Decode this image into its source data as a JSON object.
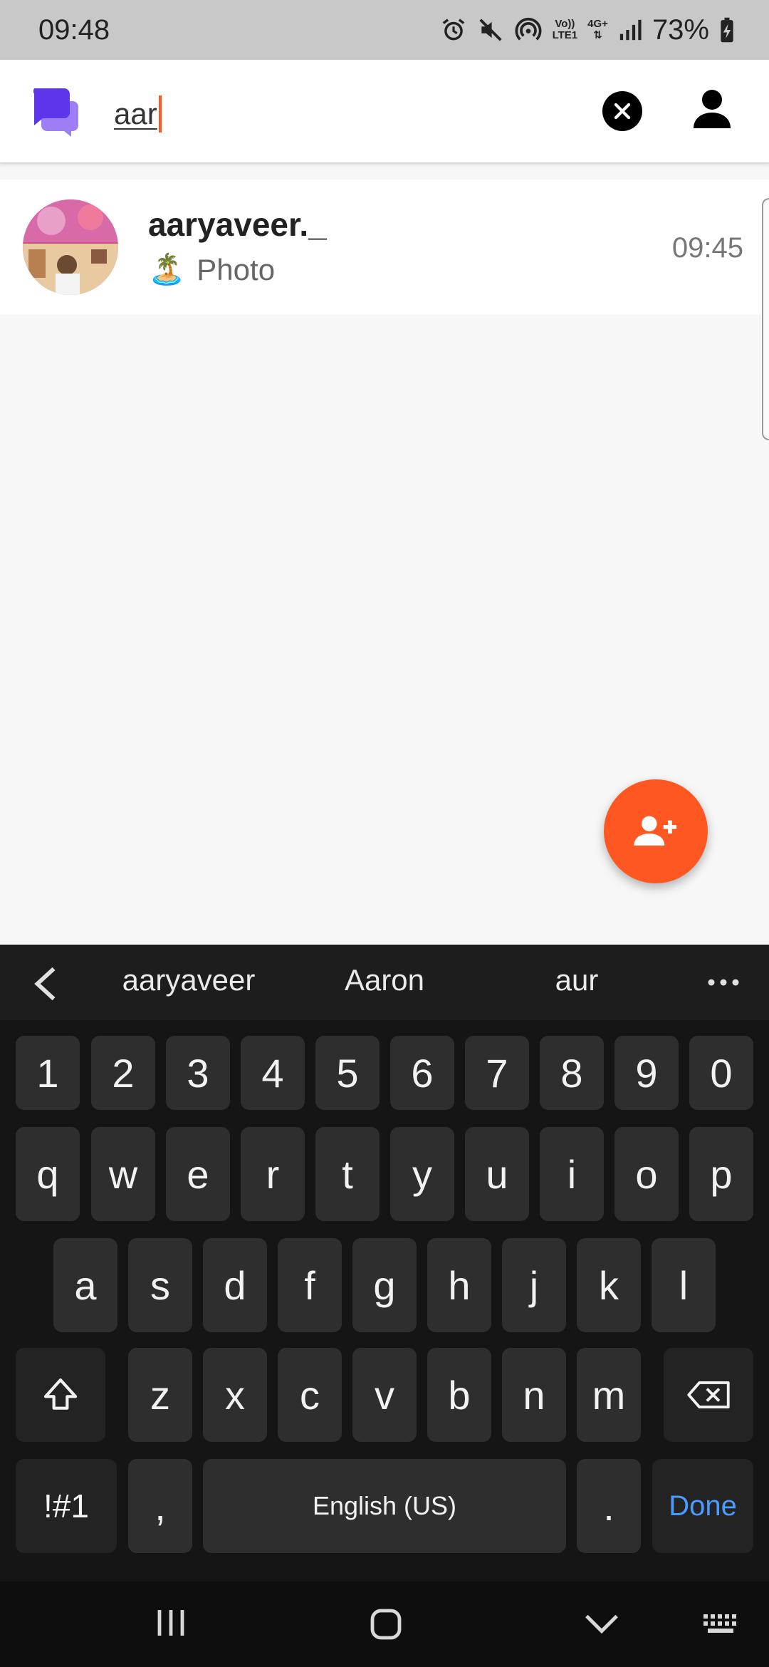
{
  "status_bar": {
    "time": "09:48",
    "battery": "73%",
    "volte_top": "Vo))",
    "volte_bottom": "LTE1",
    "network": "4G+"
  },
  "app_bar": {
    "logo_icon": "chat-bubbles-icon",
    "search_value": "aar",
    "clear_icon": "close-circle-icon",
    "profile_icon": "person-icon"
  },
  "chats": [
    {
      "name": "aaryaveer._",
      "preview_emoji": "🏝️",
      "preview": "Photo",
      "time": "09:45"
    }
  ],
  "fab": {
    "icon": "add-person-icon"
  },
  "keyboard": {
    "suggestions": [
      "aaryaveer",
      "Aaron",
      "aur"
    ],
    "row_numbers": [
      "1",
      "2",
      "3",
      "4",
      "5",
      "6",
      "7",
      "8",
      "9",
      "0"
    ],
    "row1": [
      "q",
      "w",
      "e",
      "r",
      "t",
      "y",
      "u",
      "i",
      "o",
      "p"
    ],
    "row2": [
      "a",
      "s",
      "d",
      "f",
      "g",
      "h",
      "j",
      "k",
      "l"
    ],
    "row3": [
      "z",
      "x",
      "c",
      "v",
      "b",
      "n",
      "m"
    ],
    "symbols_label": "!#1",
    "comma_label": ",",
    "space_label": "English (US)",
    "period_label": ".",
    "done_label": "Done"
  },
  "colors": {
    "accent": "#ff5722",
    "logo": "#6c4cf1",
    "done": "#4a9bff"
  }
}
